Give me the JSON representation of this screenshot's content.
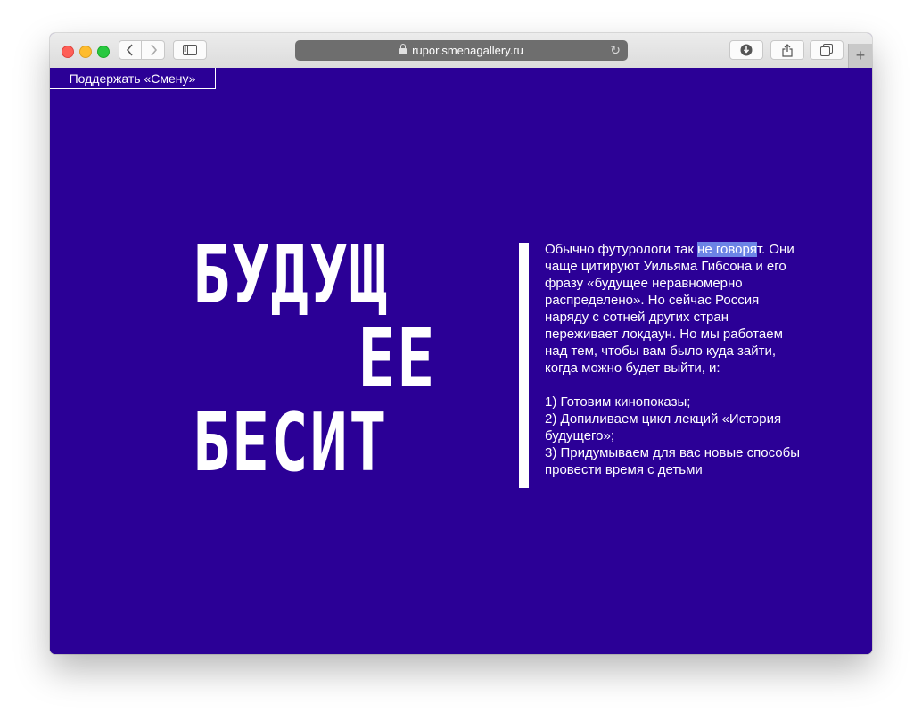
{
  "browser": {
    "url": "rupor.smenagallery.ru",
    "icons": {
      "back": "chevron-left-icon",
      "forward": "chevron-right-icon",
      "sidebar": "sidebar-icon",
      "lock": "lock-icon",
      "reload": "reload-icon",
      "download": "download-icon",
      "share": "share-icon",
      "tabs": "tabs-icon",
      "new_tab": "plus-icon"
    }
  },
  "page": {
    "support_link": "Поддержать «Смену»",
    "headline": {
      "line1": "БУДУЩ",
      "line2": "ЕЕ",
      "line3": "БЕСИТ"
    },
    "intro_before": "Обычно футурологи так ",
    "intro_highlight": "не говоря",
    "intro_after": "т.",
    "paragraph_rest": "Они чаще цитируют Уильяма Гибсона и его фразу «будущее неравномерно распределено». Но сейчас Россия наряду с сотней других стран переживает локдаун. Но мы работаем над тем, чтобы вам было куда зайти, когда можно будет выйти, и:",
    "list": [
      "1) Готовим кинопоказы;",
      "2) Допиливаем цикл лекций «История будущего»;",
      "3) Придумываем для вас новые способы провести время с детьми"
    ]
  },
  "colors": {
    "background": "#2b0096",
    "text": "#ffffff",
    "selection": "#6c84e6"
  }
}
